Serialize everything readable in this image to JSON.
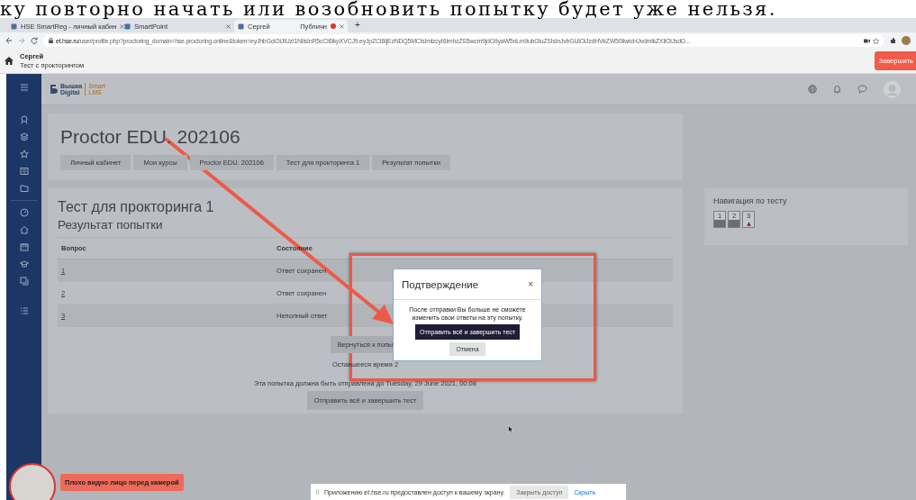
{
  "caption": "ку повторно начать или возобновить попытку будет уже нельзя.",
  "browser": {
    "tabs": [
      {
        "title": "HSE SmartReg - личный кабин",
        "recording": false,
        "selected": false
      },
      {
        "title": "SmartPoint",
        "recording": false,
        "selected": false
      },
      {
        "title": "Сергей",
        "extra": "Публичн",
        "recording": true,
        "selected": true
      }
    ],
    "new_tab": "+",
    "url_host": "et.hse.ru",
    "url_path": "/user/profile.php?proctoring_domain=hse.proctoring.online&token=eyJhbGciOiJIUzI1NiIsInR5cCI6IkpXVCJ9.eyJpZCI6IjEzNDQ5MCIsImlzcyI6ImhzZS5wcm9jdG9yaW5nLm9ubGluZSIsInJvbGUiOiJzdHVkZW50IiwicHJvdmlkZXIiOiJsdG..."
  },
  "app_header": {
    "user": "Сергей",
    "subtitle": "Тест с прокторингом",
    "finish_button": "Завершить"
  },
  "lms": {
    "logo": {
      "line1": "Вышка",
      "line2": "Digital",
      "brand1": "Smart",
      "brand2": "LMS"
    },
    "course_title": "Proctor EDU. 202106",
    "breadcrumb": [
      "Личный кабинет",
      "Мои курсы",
      "Proctor EDU. 202106",
      "Тест для прокторинга 1",
      "Результат попытки"
    ],
    "quiz_title": "Тест для прокторинга 1",
    "subtitle": "Результат попытки",
    "table": {
      "columns": [
        "Вопрос",
        "Состояние"
      ],
      "rows": [
        {
          "question": "1",
          "status": "Ответ сохранен"
        },
        {
          "question": "2",
          "status": "Ответ сохранен"
        },
        {
          "question": "3",
          "status": "Неполный ответ"
        }
      ]
    },
    "return_button": "Вернуться к попы",
    "time_left": "Оставшееся время 2",
    "deadline": "Эта попытка должна быть отправлена до Tuesday, 29 June 2021, 00:08",
    "submit_button": "Отправить всё и завершить тест"
  },
  "quiz_nav": {
    "title": "Навигация по тесту",
    "questions": [
      {
        "label": "1",
        "kind": "answered"
      },
      {
        "label": "2",
        "kind": "answered"
      },
      {
        "label": "3",
        "kind": "incomplete"
      }
    ]
  },
  "modal": {
    "title": "Подтверждение",
    "close": "×",
    "message": "После отправки Вы больше не сможете изменить свои ответы на эту попытку.",
    "confirm": "Отправить всё и завершить тест",
    "cancel": "Отмена"
  },
  "proctoring": {
    "warning": "Плохо видно лицо перед камерой"
  },
  "screen_share": {
    "message": "Приложению et.hse.ru предоставлен доступ к вашему экрану.",
    "stop_button": "Закрыть доступ",
    "hide_link": "Скрыть"
  }
}
